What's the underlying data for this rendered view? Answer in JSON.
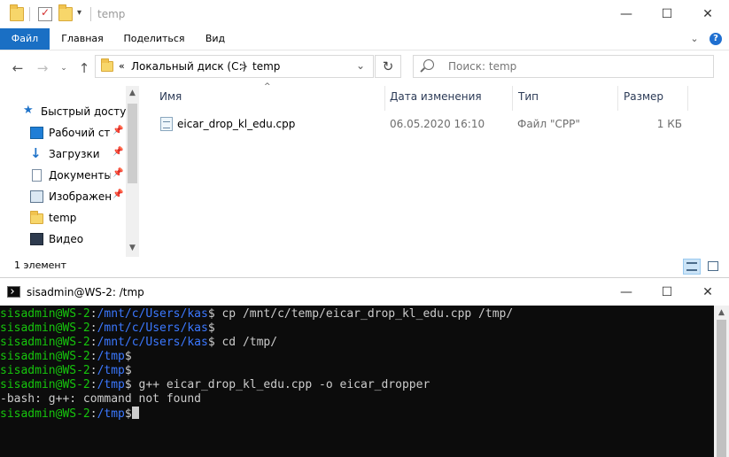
{
  "explorer": {
    "title": "temp",
    "ribbon_tabs": [
      "Файл",
      "Главная",
      "Поделиться",
      "Вид"
    ],
    "address": {
      "overflow": "«",
      "crumbs": [
        "Локальный диск (C:)",
        "temp"
      ],
      "separator": ">"
    },
    "search_placeholder": "Поиск: temp",
    "nav_items": [
      {
        "label": "Быстрый доступ",
        "icon": "star-icon"
      },
      {
        "label": "Рабочий сто",
        "icon": "desktop-icon",
        "pinned": true
      },
      {
        "label": "Загрузки",
        "icon": "download-icon",
        "pinned": true
      },
      {
        "label": "Документы",
        "icon": "documents-icon",
        "pinned": true
      },
      {
        "label": "Изображени",
        "icon": "pictures-icon",
        "pinned": true
      },
      {
        "label": "temp",
        "icon": "folder-icon"
      },
      {
        "label": "Видео",
        "icon": "video-icon"
      }
    ],
    "columns": {
      "name": "Имя",
      "date": "Дата изменения",
      "type": "Тип",
      "size": "Размер"
    },
    "files": [
      {
        "name": "eicar_drop_kl_edu.cpp",
        "date": "06.05.2020 16:10",
        "type": "Файл \"CPP\"",
        "size": "1 КБ"
      }
    ],
    "status": "1 элемент"
  },
  "terminal": {
    "title": "sisadmin@WS-2: /tmp",
    "lines": [
      {
        "user": "sisadmin@WS-2",
        "path": "/mnt/c/Users/kas",
        "cmd": " cp /mnt/c/temp/eicar_drop_kl_edu.cpp /tmp/"
      },
      {
        "user": "sisadmin@WS-2",
        "path": "/mnt/c/Users/kas",
        "cmd": ""
      },
      {
        "user": "sisadmin@WS-2",
        "path": "/mnt/c/Users/kas",
        "cmd": " cd /tmp/"
      },
      {
        "user": "sisadmin@WS-2",
        "path": "/tmp",
        "cmd": ""
      },
      {
        "user": "sisadmin@WS-2",
        "path": "/tmp",
        "cmd": ""
      },
      {
        "user": "sisadmin@WS-2",
        "path": "/tmp",
        "cmd": " g++ eicar_drop_kl_edu.cpp -o eicar_dropper"
      },
      {
        "output": "-bash: g++: command not found"
      },
      {
        "user": "sisadmin@WS-2",
        "path": "/tmp",
        "cmd": "",
        "cursor": true
      }
    ]
  }
}
